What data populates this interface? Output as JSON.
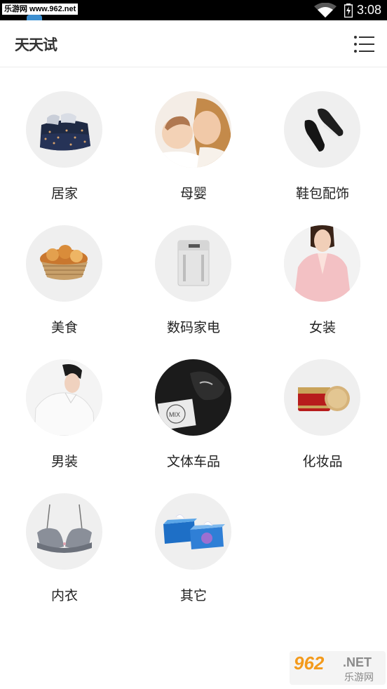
{
  "status_bar": {
    "watermark_text": "乐游网 www.962.net",
    "time": "3:08"
  },
  "app_bar": {
    "title": "天天试",
    "menu_icon": "list-menu-icon"
  },
  "categories": [
    {
      "label": "居家",
      "icon": "bedding-image"
    },
    {
      "label": "母婴",
      "icon": "mother-baby-image"
    },
    {
      "label": "鞋包配饰",
      "icon": "slip-on-shoes-image"
    },
    {
      "label": "美食",
      "icon": "bread-basket-image"
    },
    {
      "label": "数码家电",
      "icon": "air-purifier-image"
    },
    {
      "label": "女装",
      "icon": "pink-jacket-image"
    },
    {
      "label": "男装",
      "icon": "white-shirt-man-image"
    },
    {
      "label": "文体车品",
      "icon": "car-dashboard-image"
    },
    {
      "label": "化妆品",
      "icon": "cream-jars-image"
    },
    {
      "label": "内衣",
      "icon": "bra-image"
    },
    {
      "label": "其它",
      "icon": "tissue-boxes-image"
    }
  ],
  "watermark": {
    "brand": "962",
    "domain": ".NET",
    "name": "乐游网"
  }
}
